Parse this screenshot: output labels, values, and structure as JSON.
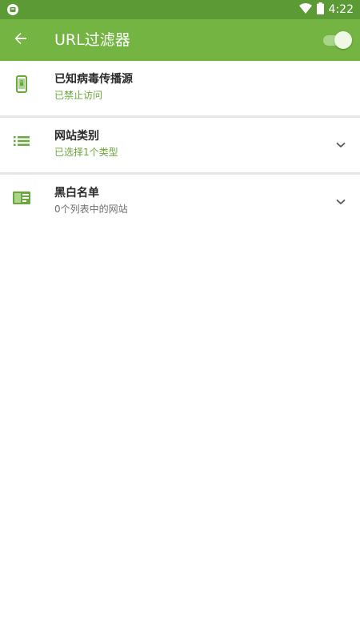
{
  "status_bar": {
    "time": "4:22",
    "left_icon": "android-notification-icon",
    "wifi_icon": "wifi-icon",
    "battery_icon": "battery-icon",
    "color": "#5b9a35"
  },
  "app_bar": {
    "title": "URL过滤器",
    "back_icon": "arrow-back-icon",
    "toggle_on": true,
    "color": "#73b443"
  },
  "items": [
    {
      "title": "已知病毒传播源",
      "subtitle": "已禁止访问",
      "subtitle_color": "#6aa83b",
      "icon": "phone-lock-icon",
      "expandable": false
    },
    {
      "title": "网站类别",
      "subtitle": "已选择1个类型",
      "subtitle_color": "#6aa83b",
      "icon": "list-icon",
      "expandable": true
    },
    {
      "title": "黑白名单",
      "subtitle": "0个列表中的网站",
      "subtitle_color": "#6f6f6f",
      "icon": "card-icon",
      "expandable": true
    }
  ]
}
